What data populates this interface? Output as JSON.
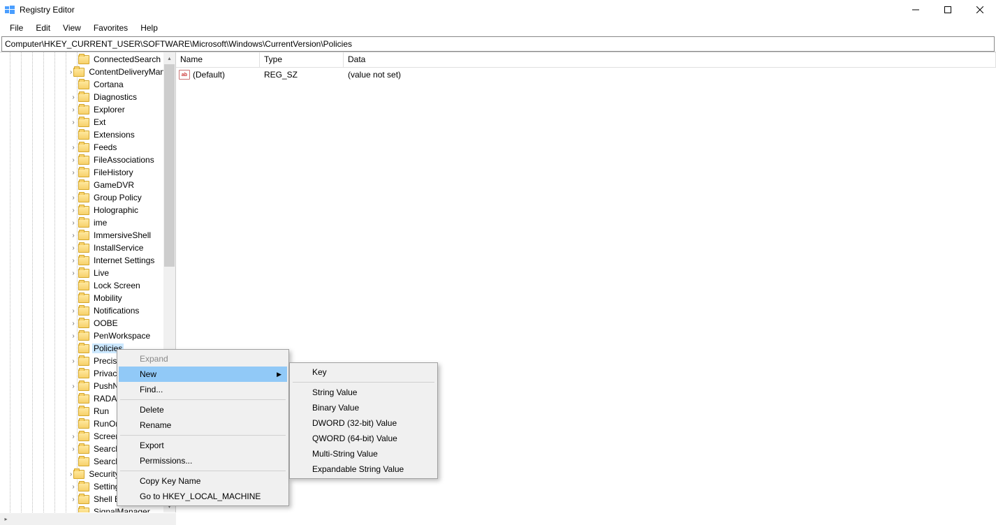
{
  "window": {
    "title": "Registry Editor"
  },
  "menu": {
    "file": "File",
    "edit": "Edit",
    "view": "View",
    "favorites": "Favorites",
    "help": "Help"
  },
  "path": "Computer\\HKEY_CURRENT_USER\\SOFTWARE\\Microsoft\\Windows\\CurrentVersion\\Policies",
  "tree": [
    {
      "label": "ConnectedSearch",
      "indent": 114,
      "chev": false
    },
    {
      "label": "ContentDeliveryManager",
      "indent": 114,
      "chev": true
    },
    {
      "label": "Cortana",
      "indent": 114,
      "chev": false
    },
    {
      "label": "Diagnostics",
      "indent": 114,
      "chev": true
    },
    {
      "label": "Explorer",
      "indent": 114,
      "chev": true
    },
    {
      "label": "Ext",
      "indent": 114,
      "chev": true
    },
    {
      "label": "Extensions",
      "indent": 114,
      "chev": false
    },
    {
      "label": "Feeds",
      "indent": 114,
      "chev": true
    },
    {
      "label": "FileAssociations",
      "indent": 114,
      "chev": true
    },
    {
      "label": "FileHistory",
      "indent": 114,
      "chev": true
    },
    {
      "label": "GameDVR",
      "indent": 114,
      "chev": false
    },
    {
      "label": "Group Policy",
      "indent": 114,
      "chev": true
    },
    {
      "label": "Holographic",
      "indent": 114,
      "chev": true
    },
    {
      "label": "ime",
      "indent": 114,
      "chev": true
    },
    {
      "label": "ImmersiveShell",
      "indent": 114,
      "chev": true
    },
    {
      "label": "InstallService",
      "indent": 114,
      "chev": true
    },
    {
      "label": "Internet Settings",
      "indent": 114,
      "chev": true
    },
    {
      "label": "Live",
      "indent": 114,
      "chev": true
    },
    {
      "label": "Lock Screen",
      "indent": 114,
      "chev": false
    },
    {
      "label": "Mobility",
      "indent": 114,
      "chev": false
    },
    {
      "label": "Notifications",
      "indent": 114,
      "chev": true
    },
    {
      "label": "OOBE",
      "indent": 114,
      "chev": true
    },
    {
      "label": "PenWorkspace",
      "indent": 114,
      "chev": true
    },
    {
      "label": "Policies",
      "indent": 114,
      "chev": false,
      "selected": true
    },
    {
      "label": "PrecisionTouchPad",
      "indent": 114,
      "chev": true
    },
    {
      "label": "Privacy",
      "indent": 114,
      "chev": false
    },
    {
      "label": "PushNotifications",
      "indent": 114,
      "chev": true
    },
    {
      "label": "RADAR",
      "indent": 114,
      "chev": false
    },
    {
      "label": "Run",
      "indent": 114,
      "chev": false
    },
    {
      "label": "RunOnce",
      "indent": 114,
      "chev": false
    },
    {
      "label": "Screensavers",
      "indent": 114,
      "chev": true
    },
    {
      "label": "Search",
      "indent": 114,
      "chev": true
    },
    {
      "label": "SearchSettings",
      "indent": 114,
      "chev": false
    },
    {
      "label": "Security and Maintenance",
      "indent": 114,
      "chev": true
    },
    {
      "label": "SettingSync",
      "indent": 114,
      "chev": true
    },
    {
      "label": "Shell Extensions",
      "indent": 114,
      "chev": true
    },
    {
      "label": "SignalManager",
      "indent": 114,
      "chev": false
    }
  ],
  "list": {
    "headers": {
      "name": "Name",
      "type": "Type",
      "data": "Data"
    },
    "rows": [
      {
        "name": "(Default)",
        "type": "REG_SZ",
        "data": "(value not set)"
      }
    ]
  },
  "context_menu": {
    "expand": "Expand",
    "new": "New",
    "find": "Find...",
    "delete": "Delete",
    "rename": "Rename",
    "export": "Export",
    "permissions": "Permissions...",
    "copy_key": "Copy Key Name",
    "goto": "Go to HKEY_LOCAL_MACHINE"
  },
  "submenu": {
    "key": "Key",
    "string": "String Value",
    "binary": "Binary Value",
    "dword": "DWORD (32-bit) Value",
    "qword": "QWORD (64-bit) Value",
    "multi": "Multi-String Value",
    "expand": "Expandable String Value"
  }
}
